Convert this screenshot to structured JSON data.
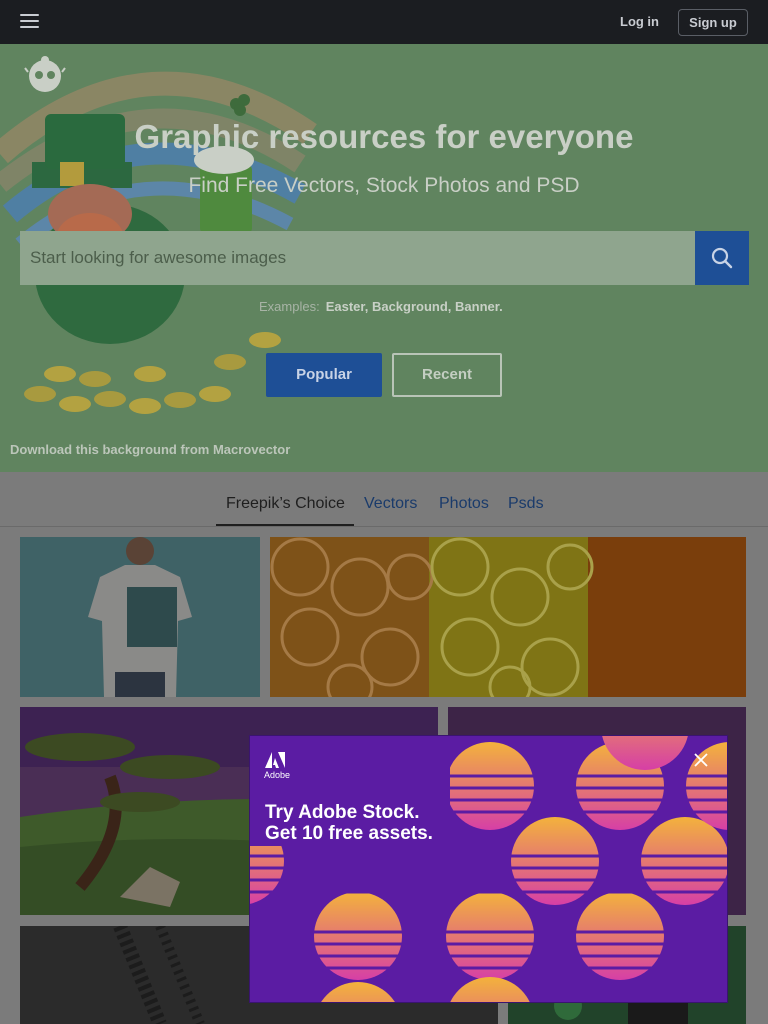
{
  "topbar": {
    "login_label": "Log in",
    "signup_label": "Sign up",
    "menu_icon": "hamburger-menu-icon",
    "background_color": "#1b1d21"
  },
  "hero": {
    "title": "Graphic resources for everyone",
    "subtitle": "Find Free Vectors, Stock Photos and PSD",
    "search_placeholder": "Start looking for awesome images",
    "search_icon": "search-icon",
    "examples_label": "Examples:",
    "examples_links": "Easter, Background, Banner.",
    "popular_label": "Popular",
    "recent_label": "Recent",
    "background_credit": "Download this background from Macrovector",
    "logo_icon": "freepik-logo-icon",
    "accent_color": "#1e4f96",
    "background_color": "#60845f"
  },
  "tabs": {
    "items": [
      {
        "label": "Freepik’s Choice",
        "active": true
      },
      {
        "label": "Vectors",
        "active": false
      },
      {
        "label": "Photos",
        "active": false
      },
      {
        "label": "Psds",
        "active": false
      }
    ]
  },
  "gallery": {
    "items": [
      {
        "name": "tshirt-mockup-thumbnail"
      },
      {
        "name": "citrus-slices-thumbnail"
      },
      {
        "name": "savanna-landscape-thumbnail"
      },
      {
        "name": "purple-pattern-thumbnail"
      },
      {
        "name": "tire-tracks-thumbnail"
      },
      {
        "name": "st-patricks-thumbnail"
      }
    ]
  },
  "ad": {
    "brand": "Adobe",
    "headline_line1": "Try Adobe Stock.",
    "headline_line2": "Get 10 free assets.",
    "close_icon": "close-icon",
    "background_color": "#5b1ca3"
  }
}
